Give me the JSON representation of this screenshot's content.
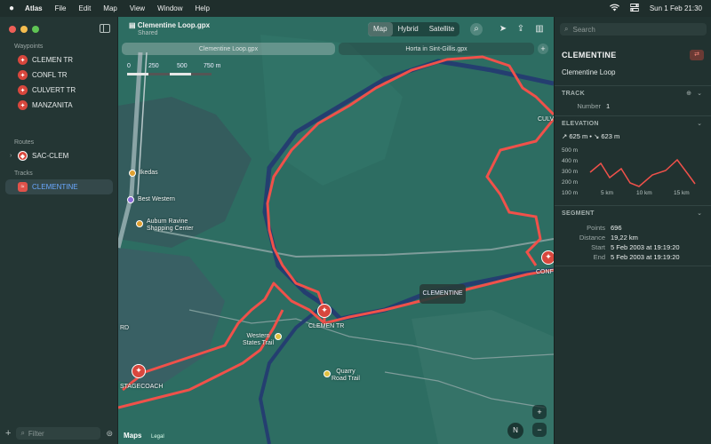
{
  "menubar": {
    "apple": "",
    "app_name": "Atlas",
    "items": [
      "File",
      "Edit",
      "Map",
      "View",
      "Window",
      "Help"
    ],
    "datetime": "Sun 1 Feb  21:30"
  },
  "sidebar": {
    "sections": {
      "waypoints": "Waypoints",
      "routes": "Routes",
      "tracks": "Tracks"
    },
    "waypoints": [
      "CLEMEN TR",
      "CONFL TR",
      "CULVERT TR",
      "MANZANITA"
    ],
    "routes": [
      "SAC-CLEM"
    ],
    "tracks": [
      "CLEMENTINE"
    ],
    "filter_placeholder": "Filter"
  },
  "toolbar": {
    "doc_title": "Clementine Loop.gpx",
    "doc_subtitle": "Shared",
    "map_modes": [
      "Map",
      "Hybrid",
      "Satellite"
    ],
    "active_mode": "Map"
  },
  "tabs": [
    "Clementine Loop.gpx",
    "Horta in Sint-Gillis.gpx"
  ],
  "map": {
    "scale_labels": [
      "0",
      "250",
      "500",
      "750 m"
    ],
    "tooltip": "CLEMENTINE",
    "labels": {
      "ikedas": "Ikedas",
      "best_western": "Best Western",
      "auburn": "Auburn Ravine\nShopping Center",
      "clemen_tr": "CLEMEN TR",
      "western_states": "Western\nStates Trail",
      "quarry": "Quarry\nRoad Trail",
      "stagecoach": "STAGECOACH",
      "culv": "CULV",
      "conf": "CONF",
      "rd": "RD"
    },
    "compass": "N",
    "logo": "Maps",
    "legal": "Legal",
    "colors": {
      "track": "#f0514a",
      "water": "#2a3c66",
      "land": "#2d6d62"
    }
  },
  "inspector": {
    "search_placeholder": "Search",
    "title": "CLEMENTINE",
    "subtitle": "Clementine Loop",
    "track_header": "TRACK",
    "track_number_label": "Number",
    "track_number": "1",
    "elevation_header": "ELEVATION",
    "elevation_stats": "↗ 625 m  •  ↘ 623 m",
    "elev_y_ticks": [
      "500 m",
      "400 m",
      "300 m",
      "200 m",
      "100 m"
    ],
    "elev_x_ticks": [
      "5 km",
      "10 km",
      "15 km"
    ],
    "segment_header": "SEGMENT",
    "segment": [
      {
        "label": "Points",
        "value": "696"
      },
      {
        "label": "Distance",
        "value": "19,22 km"
      },
      {
        "label": "Start",
        "value": "5 Feb 2003 at 19:19:20"
      },
      {
        "label": "End",
        "value": "5 Feb 2003 at 19:19:20"
      }
    ]
  }
}
